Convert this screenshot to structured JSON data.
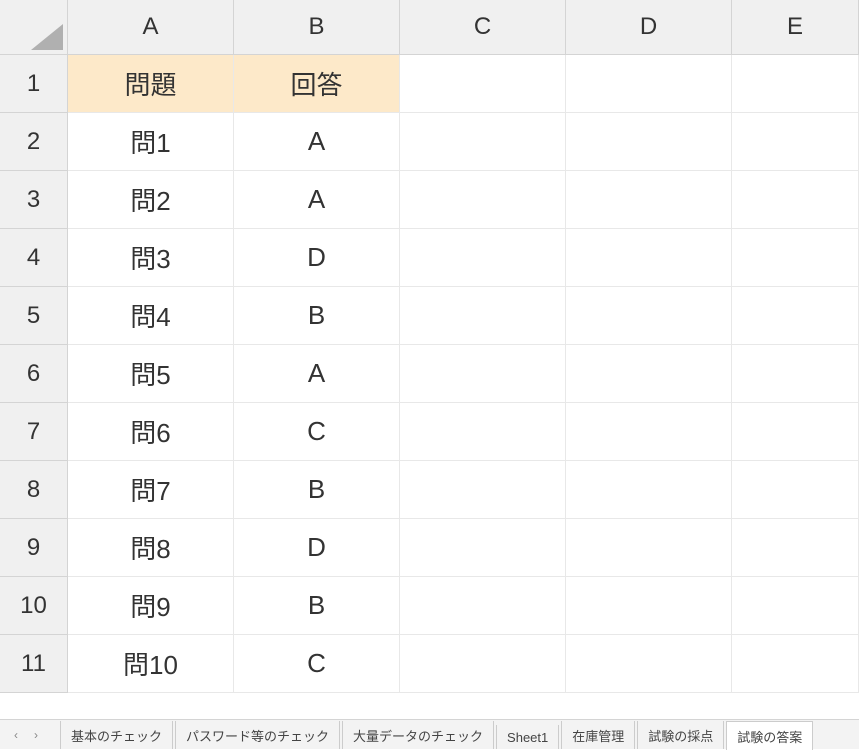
{
  "columns": [
    "A",
    "B",
    "C",
    "D",
    "E"
  ],
  "rowNumbers": [
    "1",
    "2",
    "3",
    "4",
    "5",
    "6",
    "7",
    "8",
    "9",
    "10",
    "11"
  ],
  "header": {
    "A": "問題",
    "B": "回答"
  },
  "data": [
    {
      "q": "問1",
      "a": "A"
    },
    {
      "q": "問2",
      "a": "A"
    },
    {
      "q": "問3",
      "a": "D"
    },
    {
      "q": "問4",
      "a": "B"
    },
    {
      "q": "問5",
      "a": "A"
    },
    {
      "q": "問6",
      "a": "C"
    },
    {
      "q": "問7",
      "a": "B"
    },
    {
      "q": "問8",
      "a": "D"
    },
    {
      "q": "問9",
      "a": "B"
    },
    {
      "q": "問10",
      "a": "C"
    }
  ],
  "tabs": {
    "items": [
      "基本のチェック",
      "パスワード等のチェック",
      "大量データのチェック",
      "Sheet1",
      "在庫管理",
      "試験の採点",
      "試験の答案"
    ],
    "active": "試験の答案"
  },
  "nav": {
    "prev": "‹",
    "next": "›"
  }
}
